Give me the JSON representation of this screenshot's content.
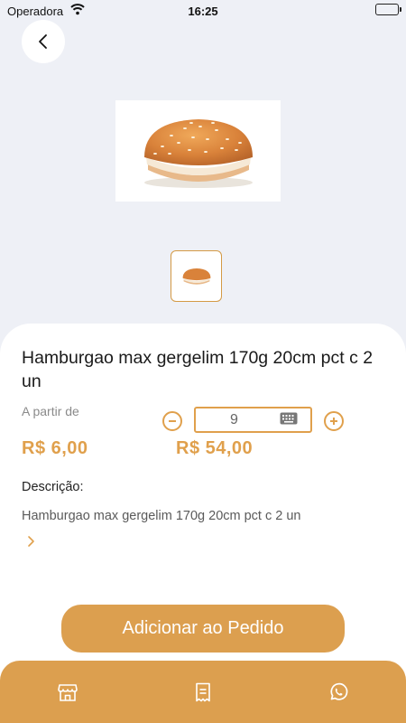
{
  "status_bar": {
    "carrier": "Operadora",
    "time": "16:25"
  },
  "product": {
    "title": "Hamburgao max  gergelim 170g 20cm pct c 2 un",
    "from_label": "A partir de",
    "unit_price": "R$ 6,00",
    "total_price": "R$ 54,00",
    "quantity": "9",
    "description_label": "Descrição:",
    "description": "Hamburgao max  gergelim 170g 20cm pct c 2 un"
  },
  "add_button": {
    "label": "Adicionar ao Pedido"
  },
  "colors": {
    "accent": "#dc9f4f",
    "accent_text": "#e0a04c",
    "background": "#eef0f6"
  },
  "bottom_nav": {
    "items": [
      {
        "icon": "store-icon"
      },
      {
        "icon": "receipt-icon"
      },
      {
        "icon": "whatsapp-icon"
      }
    ]
  }
}
